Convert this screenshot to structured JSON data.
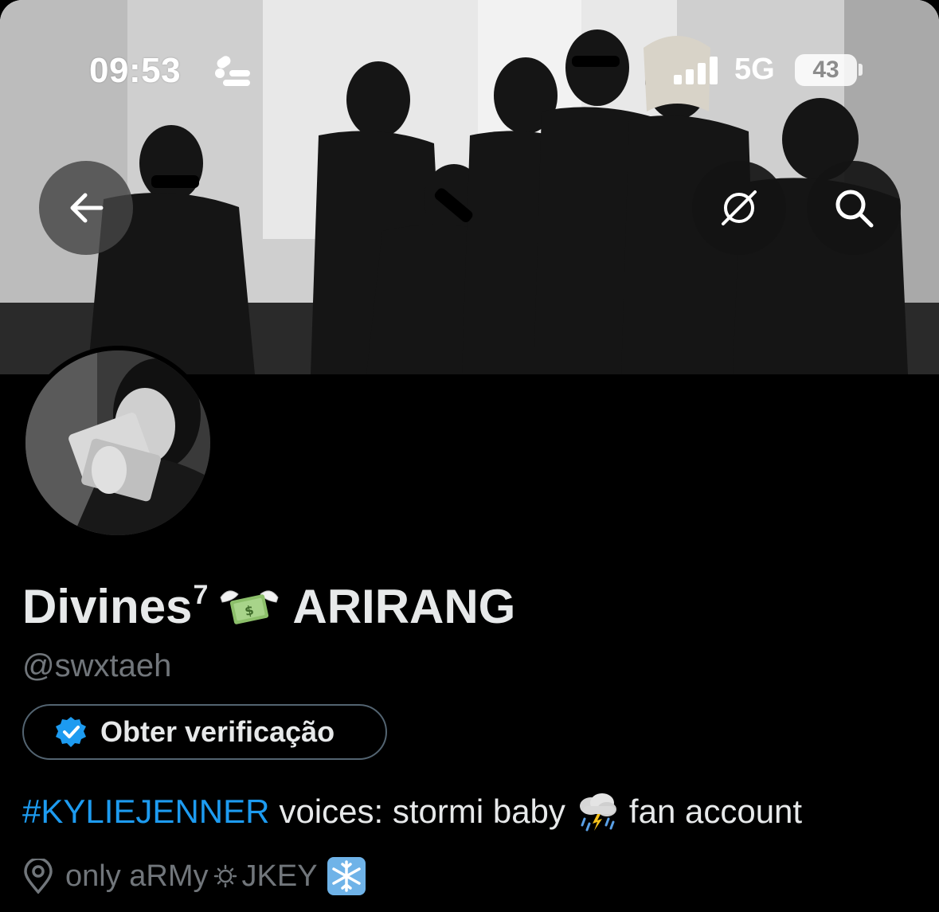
{
  "status_bar": {
    "time": "09:53",
    "network": "5G",
    "battery": "43"
  },
  "banner": {
    "description_icon": "group-photo",
    "back_icon": "arrow-left-icon",
    "grok_icon": "grok-icon",
    "search_icon": "search-icon"
  },
  "profile": {
    "display_name": "Divines",
    "display_name_sup": "7",
    "display_name_suffix": "ARIRANG",
    "handle": "@swxtaeh",
    "verify_label": "Obter verificação",
    "bio_hashtag": "#KYLIEJENNER",
    "bio_text_1": "voices: stormi baby",
    "bio_text_2": "fan account",
    "location_part_1": "only aRMy",
    "location_part_2": "JKEY"
  },
  "colors": {
    "background": "#000000",
    "text": "#e7e9ea",
    "muted": "#71767b",
    "accent": "#1d9bf0",
    "border": "#536471"
  }
}
